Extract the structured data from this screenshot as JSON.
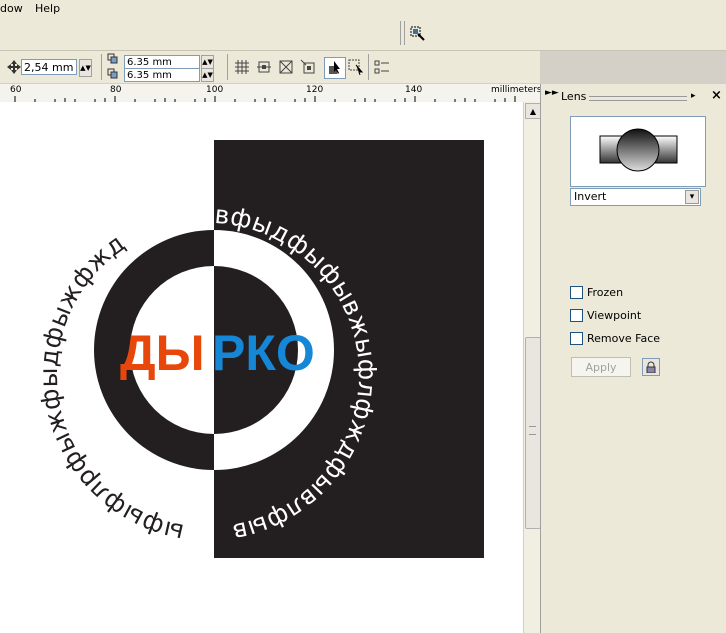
{
  "menubar": {
    "items": [
      "dow",
      "Help"
    ]
  },
  "propbar": {
    "nudge_value": "2,54 mm",
    "dup_x_value": "6.35 mm",
    "dup_y_value": "6.35 mm"
  },
  "ruler": {
    "labels": [
      "60",
      "80",
      "100",
      "120",
      "140"
    ],
    "units": "millimeters"
  },
  "canvas": {
    "center_text_left": "ДЫ",
    "center_text_right": "РКО",
    "arc_text": "ыфыфлрфыжфыдфыжфждвфыдфыфывжыфлфждфывлфывжфыi",
    "colors": {
      "red": "#e8470c",
      "blue": "#1587d6",
      "dark": "#231f20"
    }
  },
  "lens": {
    "title": "Lens",
    "effect_value": "Invert",
    "options": {
      "frozen": "Frozen",
      "viewpoint": "Viewpoint",
      "remove_face": "Remove Face"
    },
    "apply_label": "Apply"
  }
}
